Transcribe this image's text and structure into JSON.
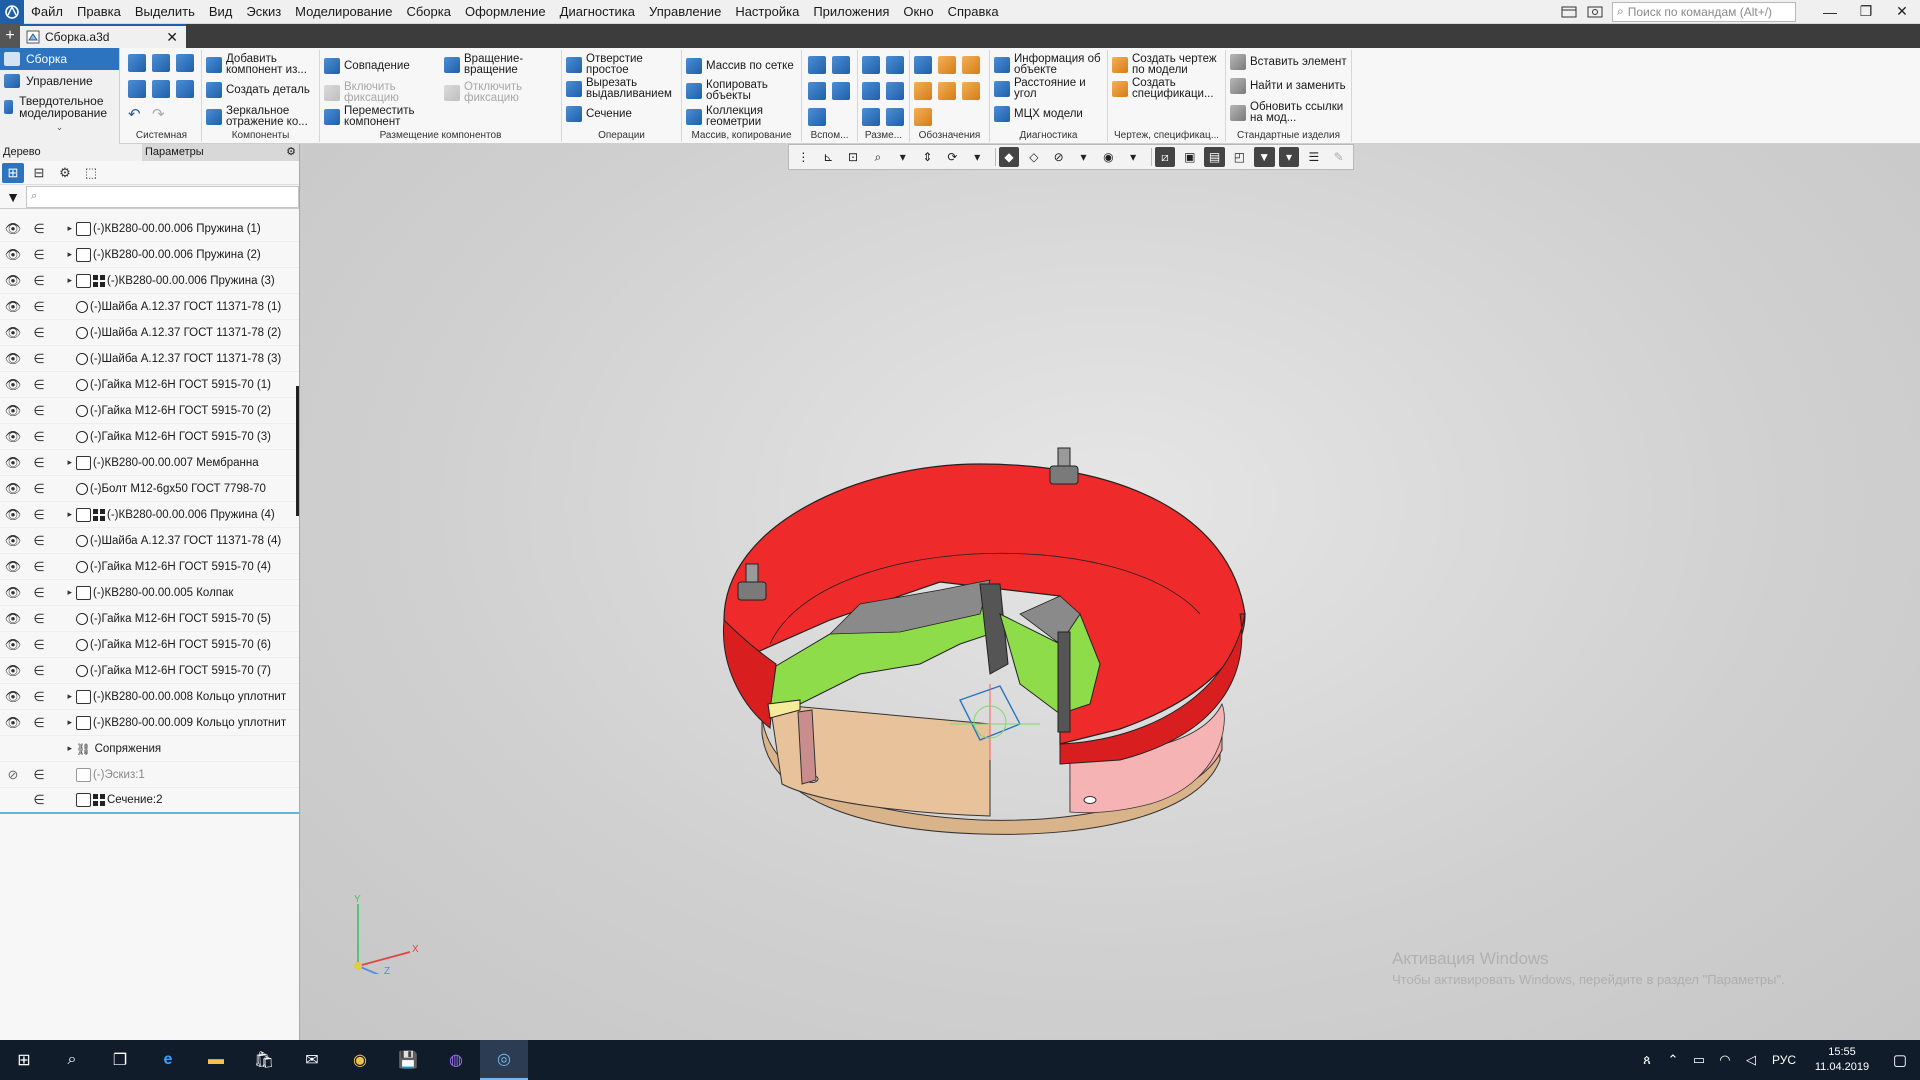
{
  "menu": {
    "items": [
      "Файл",
      "Правка",
      "Выделить",
      "Вид",
      "Эскиз",
      "Моделирование",
      "Сборка",
      "Оформление",
      "Диагностика",
      "Управление",
      "Настройка",
      "Приложения",
      "Окно",
      "Справка"
    ],
    "search_placeholder": "Поиск по командам (Alt+/)"
  },
  "document_tab": {
    "label": "Сборка.a3d"
  },
  "ribbon": {
    "modes": [
      "Сборка",
      "Управление",
      "Твердотельное моделирование"
    ],
    "panels": {
      "system": {
        "title": "Системная"
      },
      "components": {
        "title": "Компоненты",
        "add_component": "Добавить компонент из...",
        "create_part": "Создать деталь",
        "mirror": "Зеркальное отражение ко..."
      },
      "placement": {
        "title": "Размещение компонентов",
        "coincidence": "Совпадение",
        "enable_fix": "Включить фиксацию",
        "move_component": "Переместить компонент",
        "rotation": "Вращение-вращение",
        "disable_fix": "Отключить фиксацию"
      },
      "operations": {
        "title": "Операции",
        "hole": "Отверстие простое",
        "cut_extrude": "Вырезать выдавливанием",
        "section": "Сечение"
      },
      "array": {
        "title": "Массив, копирование",
        "grid_array": "Массив по сетке",
        "copy_objects": "Копировать объекты",
        "geometry_collection": "Коллекция геометрии"
      },
      "aux": {
        "title": "Вспом..."
      },
      "dims": {
        "title": "Разме..."
      },
      "designations": {
        "title": "Обозначения"
      },
      "diagnostics": {
        "title": "Диагностика",
        "object_info": "Информация об объекте",
        "distance_angle": "Расстояние и угол",
        "mass_props": "МЦХ модели"
      },
      "drawing": {
        "title": "Чертеж, спецификац...",
        "create_drawing": "Создать чертеж по модели",
        "create_spec": "Создать спецификаци..."
      },
      "standard": {
        "title": "Стандартные изделия",
        "insert_element": "Вставить элемент",
        "find_replace": "Найти и заменить",
        "update_links": "Обновить ссылки на мод..."
      }
    }
  },
  "tree_panel": {
    "tab_tree": "Дерево",
    "tab_params": "Параметры",
    "filter_placeholder": "",
    "rows": [
      {
        "name": "(-)КВ280-00.00.006 Пружина (1)",
        "kind": "asm",
        "expand": true,
        "visible": true
      },
      {
        "name": "(-)КВ280-00.00.006 Пружина (2)",
        "kind": "asm",
        "expand": true,
        "visible": true
      },
      {
        "name": "(-)КВ280-00.00.006 Пружина (3)",
        "kind": "asm-array",
        "expand": true,
        "visible": true
      },
      {
        "name": "(-)Шайба А.12.37 ГОСТ 11371-78 (1)",
        "kind": "part",
        "expand": false,
        "visible": true
      },
      {
        "name": "(-)Шайба А.12.37 ГОСТ 11371-78 (2)",
        "kind": "part",
        "expand": false,
        "visible": true
      },
      {
        "name": "(-)Шайба А.12.37 ГОСТ 11371-78 (3)",
        "kind": "part",
        "expand": false,
        "visible": true
      },
      {
        "name": "(-)Гайка М12-6Н ГОСТ 5915-70 (1)",
        "kind": "part",
        "expand": false,
        "visible": true
      },
      {
        "name": "(-)Гайка М12-6Н ГОСТ 5915-70 (2)",
        "kind": "part",
        "expand": false,
        "visible": true
      },
      {
        "name": "(-)Гайка М12-6Н ГОСТ 5915-70 (3)",
        "kind": "part",
        "expand": false,
        "visible": true
      },
      {
        "name": "(-)КВ280-00.00.007 Мембранна",
        "kind": "asm",
        "expand": true,
        "visible": true
      },
      {
        "name": "(-)Болт М12-6gx50 ГОСТ 7798-70",
        "kind": "part",
        "expand": false,
        "visible": true
      },
      {
        "name": "(-)КВ280-00.00.006 Пружина (4)",
        "kind": "asm-array",
        "expand": true,
        "visible": true
      },
      {
        "name": "(-)Шайба А.12.37 ГОСТ 11371-78 (4)",
        "kind": "part",
        "expand": false,
        "visible": true
      },
      {
        "name": "(-)Гайка М12-6Н ГОСТ 5915-70 (4)",
        "kind": "part",
        "expand": false,
        "visible": true
      },
      {
        "name": "(-)КВ280-00.00.005 Колпак",
        "kind": "asm",
        "expand": true,
        "visible": true
      },
      {
        "name": "(-)Гайка М12-6Н ГОСТ 5915-70 (5)",
        "kind": "part",
        "expand": false,
        "visible": true
      },
      {
        "name": "(-)Гайка М12-6Н ГОСТ 5915-70 (6)",
        "kind": "part",
        "expand": false,
        "visible": true
      },
      {
        "name": "(-)Гайка М12-6Н ГОСТ 5915-70 (7)",
        "kind": "part",
        "expand": false,
        "visible": true
      },
      {
        "name": "(-)КВ280-00.00.008 Кольцо уплотнит",
        "kind": "asm",
        "expand": true,
        "visible": true
      },
      {
        "name": "(-)КВ280-00.00.009 Кольцо уплотнит",
        "kind": "asm",
        "expand": true,
        "visible": true
      },
      {
        "name": "Сопряжения",
        "kind": "mates",
        "expand": true,
        "visible": null
      },
      {
        "name": "(-)Эскиз:1",
        "kind": "sketch",
        "expand": false,
        "visible": false
      },
      {
        "name": "Сечение:2",
        "kind": "section",
        "expand": false,
        "visible": null
      }
    ]
  },
  "viewport": {
    "axes": {
      "x": "X",
      "y": "Y",
      "z": "Z"
    },
    "watermark_title": "Активация Windows",
    "watermark_sub": "Чтобы активировать Windows, перейдите в раздел \"Параметры\"."
  },
  "taskbar": {
    "lang": "РУС",
    "time": "15:55",
    "date": "11.04.2019"
  },
  "colors": {
    "accent": "#2c74c0",
    "model_red": "#ee2a2a",
    "model_green": "#8fdc4a",
    "model_tan": "#e7c29a",
    "model_pink": "#f2a6a6"
  }
}
